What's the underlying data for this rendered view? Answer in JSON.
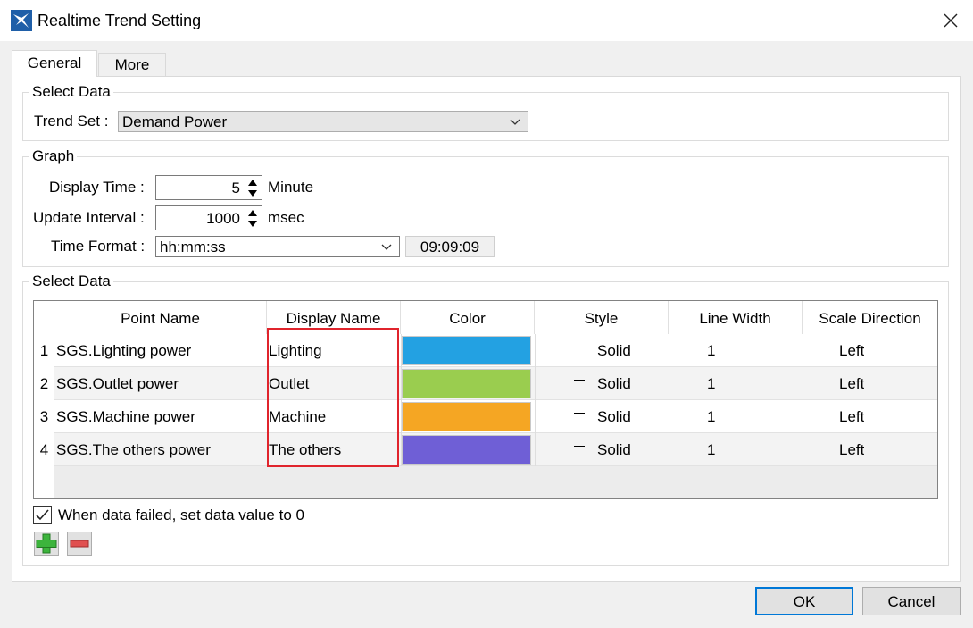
{
  "window": {
    "title": "Realtime Trend Setting",
    "close_glyph": "close-icon"
  },
  "tabs": [
    {
      "label": "General"
    },
    {
      "label": "More"
    }
  ],
  "select_data_group": {
    "title": "Select Data",
    "trend_set_label": "Trend Set :",
    "trend_set_value": "Demand Power"
  },
  "graph_group": {
    "title": "Graph",
    "display_time_label": "Display Time :",
    "display_time_value": "5",
    "display_time_unit": "Minute",
    "update_interval_label": "Update Interval :",
    "update_interval_value": "1000",
    "update_interval_unit": "msec",
    "time_format_label": "Time Format :",
    "time_format_value": "hh:mm:ss",
    "time_preview": "09:09:09"
  },
  "data_group": {
    "title": "Select Data",
    "columns": [
      "Point Name",
      "Display Name",
      "Color",
      "Style",
      "Line Width",
      "Scale Direction"
    ],
    "rows": [
      {
        "num": "1",
        "point": "SGS.Lighting power",
        "display": "Lighting",
        "color": "#23a1e2",
        "style": "Solid",
        "width": "1",
        "scale": "Left"
      },
      {
        "num": "2",
        "point": "SGS.Outlet power",
        "display": "Outlet",
        "color": "#9acd4f",
        "style": "Solid",
        "width": "1",
        "scale": "Left"
      },
      {
        "num": "3",
        "point": "SGS.Machine power",
        "display": "Machine",
        "color": "#f5a623",
        "style": "Solid",
        "width": "1",
        "scale": "Left"
      },
      {
        "num": "4",
        "point": "SGS.The others power",
        "display": "The others",
        "color": "#6f5fd6",
        "style": "Solid",
        "width": "1",
        "scale": "Left"
      }
    ],
    "fail_checkbox_label": "When data failed, set data value to 0",
    "fail_checkbox_checked": true
  },
  "footer": {
    "ok_label": "OK",
    "cancel_label": "Cancel"
  },
  "colors": {
    "accent": "#0078d7",
    "highlight": "#e0242c",
    "add_green": "#3cb43c",
    "remove_red": "#e05050"
  }
}
